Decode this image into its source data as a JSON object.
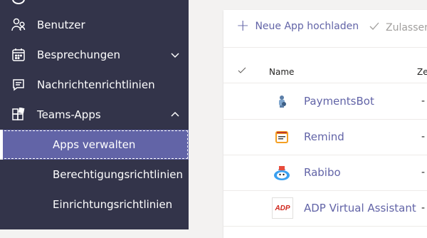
{
  "sidebar": {
    "items": [
      {
        "label": "Benutzer",
        "icon": "users-icon"
      },
      {
        "label": "Besprechungen",
        "icon": "calendar-icon"
      },
      {
        "label": "Nachrichtenrichtlinien",
        "icon": "message-icon"
      },
      {
        "label": "Teams-Apps",
        "icon": "apps-icon"
      }
    ],
    "subitems": [
      {
        "label": "Apps verwalten",
        "active": true
      },
      {
        "label": "Berechtigungsrichtlinien"
      },
      {
        "label": "Einrichtungsrichtlinien"
      }
    ]
  },
  "toolbar": {
    "upload_label": "Neue App hochladen",
    "allow_label": "Zulassen"
  },
  "table": {
    "columns": [
      "Name",
      "Ze"
    ],
    "rows": [
      {
        "name": "PaymentsBot",
        "icon": "paymentsbot-icon",
        "col2": "-"
      },
      {
        "name": "Remind",
        "icon": "remind-icon",
        "col2": "-"
      },
      {
        "name": "Rabibo",
        "icon": "rabibo-icon",
        "col2": "-"
      },
      {
        "name": "ADP Virtual Assistant",
        "icon": "adp-icon",
        "col2": "-",
        "logo_text": "ADP"
      }
    ]
  },
  "colors": {
    "sidebar_bg": "#33344a",
    "accent": "#6264a7",
    "content_bg": "#f3f2f1"
  }
}
